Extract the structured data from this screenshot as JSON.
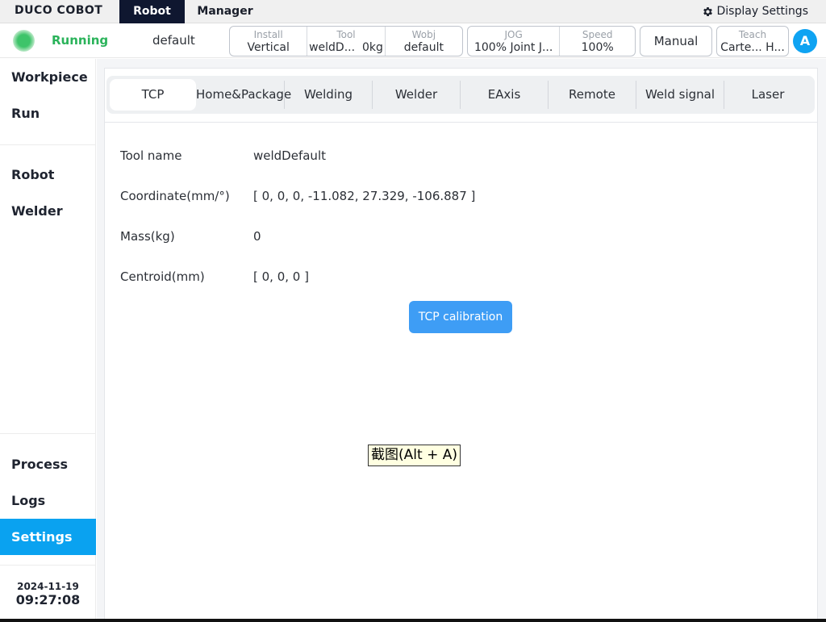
{
  "topbar": {
    "logo": "DUCO COBOT",
    "tabs": [
      "Robot",
      "Manager"
    ],
    "display_settings": "Display Settings"
  },
  "status": {
    "state": "Running",
    "project": "default",
    "install_caption": "Install",
    "install_value": "Vertical",
    "tool_caption": "Tool",
    "tool_value": "weldD...",
    "tool_mass": "0kg",
    "wobj_caption": "Wobj",
    "wobj_value": "default",
    "jog_caption": "JOG",
    "jog_value": "100% Joint J...",
    "speed_caption": "Speed",
    "speed_value": "100%",
    "mode": "Manual",
    "teach_caption": "Teach",
    "teach_value": "Carte... H...",
    "avatar": "A"
  },
  "sidebar": {
    "items": [
      "Workpiece",
      "Run",
      "Robot",
      "Welder",
      "Process",
      "Logs",
      "Settings"
    ],
    "active": "Settings",
    "date": "2024-11-19",
    "time": "09:27:08"
  },
  "tabs": [
    "TCP",
    "Home&Package",
    "Welding",
    "Welder",
    "EAxis",
    "Remote",
    "Weld signal",
    "Laser"
  ],
  "tcp": {
    "tool_name_label": "Tool name",
    "tool_name_value": "weldDefault",
    "coordinate_label": "Coordinate(mm/°)",
    "coordinate_value": "[ 0, 0, 0, -11.082, 27.329, -106.887 ]",
    "mass_label": "Mass(kg)",
    "mass_value": "0",
    "centroid_label": "Centroid(mm)",
    "centroid_value": "[ 0, 0, 0 ]",
    "calibration_button": "TCP calibration"
  },
  "tooltip": "截图(Alt + A)",
  "colors": {
    "accent": "#0aa2f0",
    "running": "#2ab35a",
    "button": "#3e9df5",
    "topbar_active": "#0f1730"
  }
}
